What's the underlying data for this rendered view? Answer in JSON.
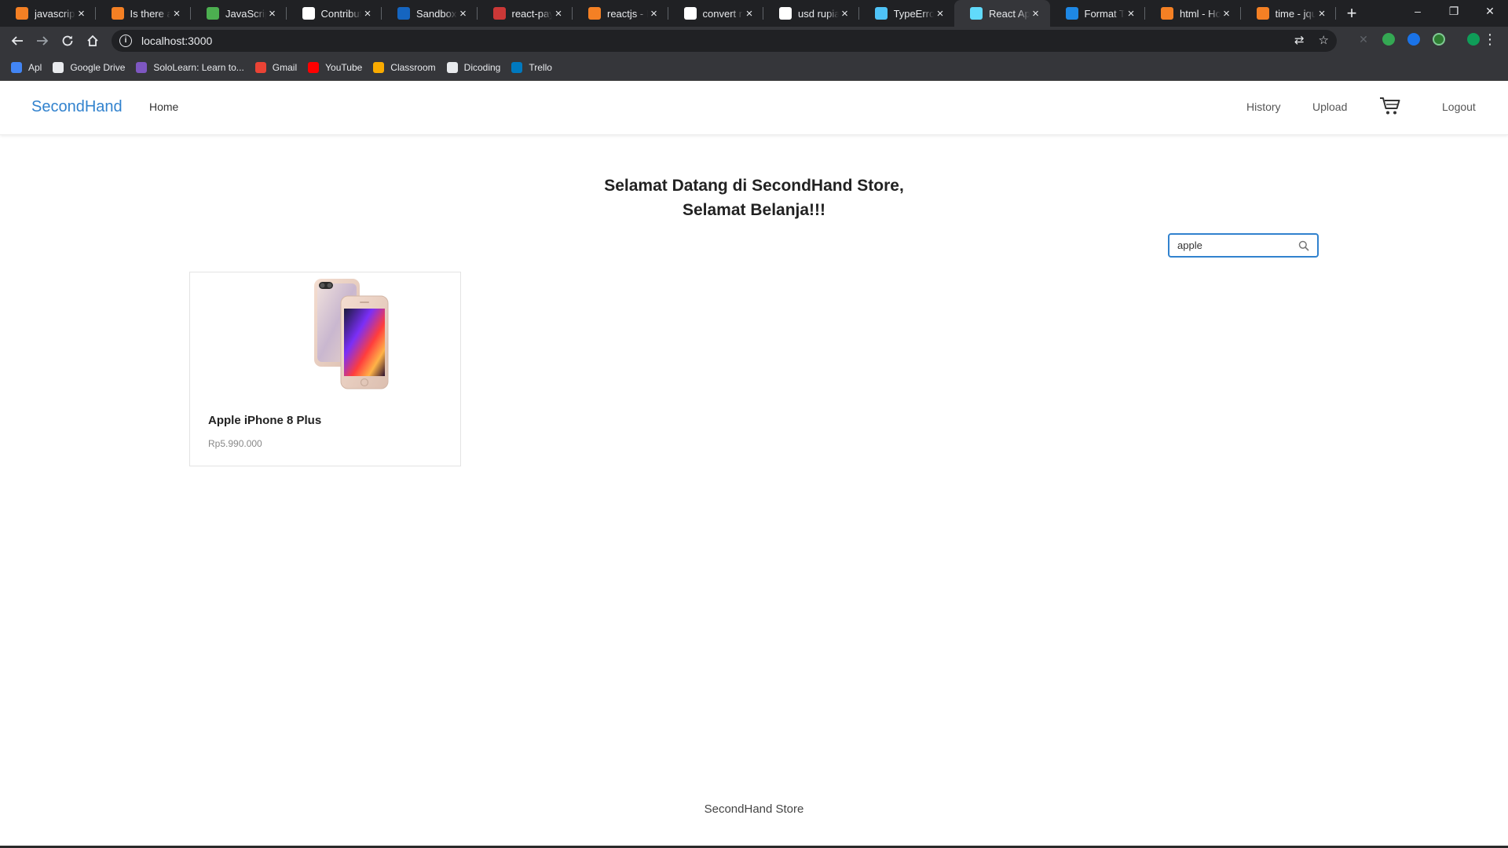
{
  "browser": {
    "tabs": [
      {
        "title": "javascript",
        "favicon": "stackoverflow-icon",
        "color": "#f48024"
      },
      {
        "title": "Is there a",
        "favicon": "stackoverflow-icon",
        "color": "#f48024"
      },
      {
        "title": "JavaScript",
        "favicon": "chart-favicon-icon",
        "color": "#4caf50"
      },
      {
        "title": "Contributo",
        "favicon": "github-icon",
        "color": "#ffffff"
      },
      {
        "title": "Sandbox a",
        "favicon": "paypal-icon",
        "color": "#1565c0"
      },
      {
        "title": "react-payp",
        "favicon": "npm-icon",
        "color": "#cb3837"
      },
      {
        "title": "reactjs - R",
        "favicon": "stackoverflow-icon",
        "color": "#f48024"
      },
      {
        "title": "convert ru",
        "favicon": "google-icon",
        "color": "#ffffff"
      },
      {
        "title": "usd rupiah",
        "favicon": "google-icon",
        "color": "#ffffff"
      },
      {
        "title": "TypeError",
        "favicon": "bug-icon",
        "color": "#4fc3f7"
      },
      {
        "title": "React App",
        "favicon": "react-icon",
        "color": "#61dafb",
        "active": true
      },
      {
        "title": "Format Ta",
        "favicon": "c-icon",
        "color": "#1e88e5"
      },
      {
        "title": "html - How",
        "favicon": "stackoverflow-icon",
        "color": "#f48024"
      },
      {
        "title": "time - jque",
        "favicon": "stackoverflow-icon",
        "color": "#f48024"
      }
    ],
    "new_tab_label": "+",
    "window_controls": {
      "minimize": "–",
      "restore": "❐",
      "close": "✕"
    },
    "url": "localhost:3000",
    "bookmarks": [
      {
        "label": "Apl",
        "color": "#4285f4"
      },
      {
        "label": "Google Drive",
        "color": "#e8eaed"
      },
      {
        "label": "SoloLearn: Learn to...",
        "color": "#7e57c2"
      },
      {
        "label": "Gmail",
        "color": "#ea4335"
      },
      {
        "label": "YouTube",
        "color": "#ff0000"
      },
      {
        "label": "Classroom",
        "color": "#f9ab00"
      },
      {
        "label": "Dicoding",
        "color": "#e8eaed"
      },
      {
        "label": "Trello",
        "color": "#0079bf"
      }
    ]
  },
  "navbar": {
    "brand": "SecondHand",
    "home": "Home",
    "history": "History",
    "upload": "Upload",
    "logout": "Logout",
    "brand_color": "#3182ce"
  },
  "welcome": {
    "line1": "Selamat Datang di SecondHand Store,",
    "line2": "Selamat Belanja!!!"
  },
  "search": {
    "value": "apple"
  },
  "products": [
    {
      "name": "Apple iPhone 8 Plus",
      "price": "Rp5.990.000"
    }
  ],
  "footer": {
    "text": "SecondHand Store"
  }
}
